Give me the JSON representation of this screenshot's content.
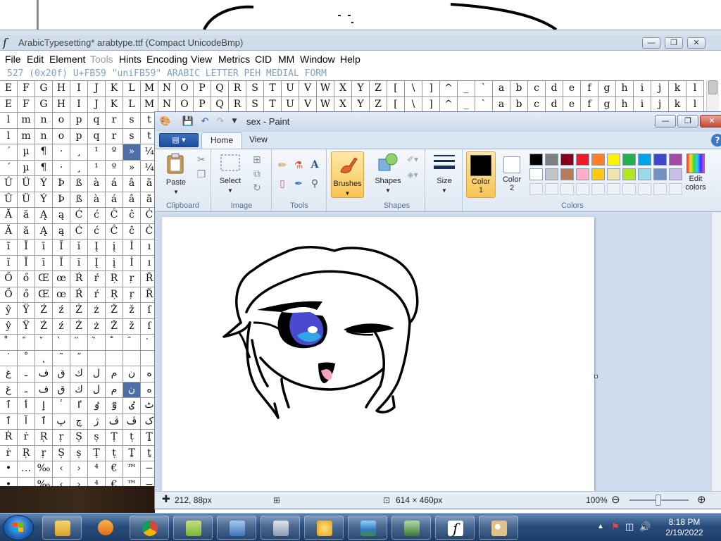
{
  "fontforge": {
    "title": "ArabicTypesetting*  arabtype.ttf (Compact UnicodeBmp)",
    "menu": [
      {
        "label": "File",
        "enabled": true
      },
      {
        "label": "Edit",
        "enabled": true
      },
      {
        "label": "Element",
        "enabled": true
      },
      {
        "label": "Tools",
        "enabled": false
      },
      {
        "label": "Hints",
        "enabled": true
      },
      {
        "label": "Encoding",
        "enabled": true
      },
      {
        "label": "View",
        "enabled": true
      },
      {
        "label": "Metrics",
        "enabled": true
      },
      {
        "label": "CID",
        "enabled": true
      },
      {
        "label": "MM",
        "enabled": true
      },
      {
        "label": "Window",
        "enabled": true
      },
      {
        "label": "Help",
        "enabled": true
      }
    ],
    "info_line": "527 (0x20f) U+FB59 \"uniFB59\" ARABIC LETTER PEH MEDIAL FORM",
    "glyph_rows": [
      [
        "E",
        "F",
        "G",
        "H",
        "I",
        "J",
        "K",
        "L",
        "M",
        "N",
        "O",
        "P",
        "Q",
        "R",
        "S",
        "T",
        "U",
        "V",
        "W",
        "X",
        "Y",
        "Z",
        "[",
        "\\",
        "]",
        "^",
        "_",
        "`",
        "a",
        "b",
        "c",
        "d",
        "e",
        "f",
        "g",
        "h",
        "i",
        "j",
        "k",
        "l"
      ],
      [
        "E",
        "F",
        "G",
        "H",
        "I",
        "J",
        "K",
        "L",
        "M",
        "N",
        "O",
        "P",
        "Q",
        "R",
        "S",
        "T",
        "U",
        "V",
        "W",
        "X",
        "Y",
        "Z",
        "[",
        "\\",
        "]",
        "^",
        "_",
        "`",
        "a",
        "b",
        "c",
        "d",
        "e",
        "f",
        "g",
        "h",
        "i",
        "j",
        "k",
        "l"
      ],
      [
        "l",
        "m",
        "n",
        "o",
        "p",
        "q",
        "r",
        "s",
        "t"
      ],
      [
        "l",
        "m",
        "n",
        "o",
        "p",
        "q",
        "r",
        "s",
        "t"
      ],
      [
        "´",
        "µ",
        "¶",
        "·",
        "¸",
        "¹",
        "º",
        "»",
        "¼"
      ],
      [
        "´",
        "µ",
        "¶",
        "·",
        "¸",
        "¹",
        "º",
        "»",
        "¼"
      ],
      [
        "Û",
        "Ü",
        "Ý",
        "Þ",
        "ß",
        "à",
        "á",
        "â",
        "ã"
      ],
      [
        "Û",
        "Ü",
        "Ý",
        "Þ",
        "ß",
        "à",
        "á",
        "â",
        "ã"
      ],
      [
        "Ă",
        "ă",
        "Ą",
        "ą",
        "Ć",
        "ć",
        "Ĉ",
        "ĉ",
        "Ċ"
      ],
      [
        "Ă",
        "ă",
        "Ą",
        "ą",
        "Ć",
        "ć",
        "Ĉ",
        "ĉ",
        "Ċ"
      ],
      [
        "ĩ",
        "Ī",
        "ī",
        "Ĭ",
        "ĭ",
        "Į",
        "į",
        "İ",
        "ı"
      ],
      [
        "ĩ",
        "Ī",
        "ī",
        "Ĭ",
        "ĭ",
        "Į",
        "į",
        "İ",
        "ı"
      ],
      [
        "Ő",
        "ő",
        "Œ",
        "œ",
        "Ŕ",
        "ŕ",
        "Ŗ",
        "ŗ",
        "Ř"
      ],
      [
        "Ő",
        "ő",
        "Œ",
        "œ",
        "Ŕ",
        "ŕ",
        "Ŗ",
        "ŗ",
        "Ř"
      ],
      [
        "ŷ",
        "Ÿ",
        "Ź",
        "ź",
        "Ż",
        "ż",
        "Ž",
        "ž",
        "ſ"
      ],
      [
        "ŷ",
        "Ÿ",
        "Ź",
        "ź",
        "Ż",
        "ż",
        "Ž",
        "ž",
        "ſ"
      ],
      [
        "̊",
        "̋",
        "̌",
        "̍",
        "̎",
        "̏",
        "̐",
        "̑",
        "̒"
      ],
      [
        "˙",
        "˚",
        "˛",
        "˜",
        "˝",
        "",
        "",
        "",
        ""
      ],
      [
        "غ",
        "ـ",
        "ف",
        "ق",
        "ك",
        "ل",
        "م",
        "ن",
        "ه"
      ],
      [
        "غ",
        "ـ",
        "ف",
        "ق",
        "ك",
        "ل",
        "م",
        "ن",
        "ه"
      ],
      [
        "ٱ",
        "ٲ",
        "ٳ",
        "ٴ",
        "ٵ",
        "ٶ",
        "ٷ",
        "ٸ",
        "ٹ"
      ],
      [
        "ٱ",
        "آ",
        "ٱ",
        "پ",
        "چ",
        "ژ",
        "ڤ",
        "ڦ",
        "ک"
      ],
      [
        "Ṙ",
        "ṙ",
        "Ṛ",
        "ṛ",
        "Ṣ",
        "ṣ",
        "Ṭ",
        "ṭ",
        "Ṯ"
      ],
      [
        "ṙ",
        "Ṛ",
        "ṛ",
        "Ṣ",
        "ṣ",
        "Ṭ",
        "ṭ",
        "Ṯ",
        "ṯ"
      ],
      [
        "•",
        "…",
        "‰",
        "‹",
        "›",
        "⁴",
        "€",
        "™",
        "−"
      ],
      [
        "•",
        "…",
        "‰",
        "‹",
        "›",
        "⁴",
        "€",
        "™",
        "−"
      ]
    ]
  },
  "paint": {
    "title": "sex - Paint",
    "tabs": [
      "Home",
      "View"
    ],
    "groups": {
      "clipboard": {
        "label": "Clipboard",
        "paste": "Paste"
      },
      "image": {
        "label": "Image",
        "select": "Select"
      },
      "tools": {
        "label": "Tools"
      },
      "brushes": {
        "label": "Brushes"
      },
      "shapes": {
        "label": "Shapes",
        "shapes_btn": "Shapes"
      },
      "size": {
        "label": "Size"
      },
      "colors": {
        "label": "Colors",
        "color1": "Color\n1",
        "color2": "Color\n2",
        "edit": "Edit\ncolors",
        "color1_value": "#000000",
        "color2_value": "#ffffff",
        "palette_row1": [
          "#000000",
          "#7f7f7f",
          "#880015",
          "#ed1c24",
          "#ff7f27",
          "#fff200",
          "#22b14c",
          "#00a2e8",
          "#3f48cc",
          "#a349a4"
        ],
        "palette_row2": [
          "#ffffff",
          "#c3c3c3",
          "#b97a57",
          "#ffaec9",
          "#ffc90e",
          "#efe4b0",
          "#b5e61d",
          "#99d9ea",
          "#7092be",
          "#c8bfe7"
        ]
      }
    },
    "status": {
      "cursor": "212, 88px",
      "image_size": "614 × 460px",
      "zoom": "100%"
    }
  },
  "taskbar": {
    "apps": [
      "explorer",
      "media",
      "chrome",
      "folder",
      "search",
      "keyboard",
      "messenger",
      "photos",
      "terminal",
      "fontforge",
      "paint"
    ],
    "time": "8:18 PM",
    "date": "2/19/2022"
  }
}
